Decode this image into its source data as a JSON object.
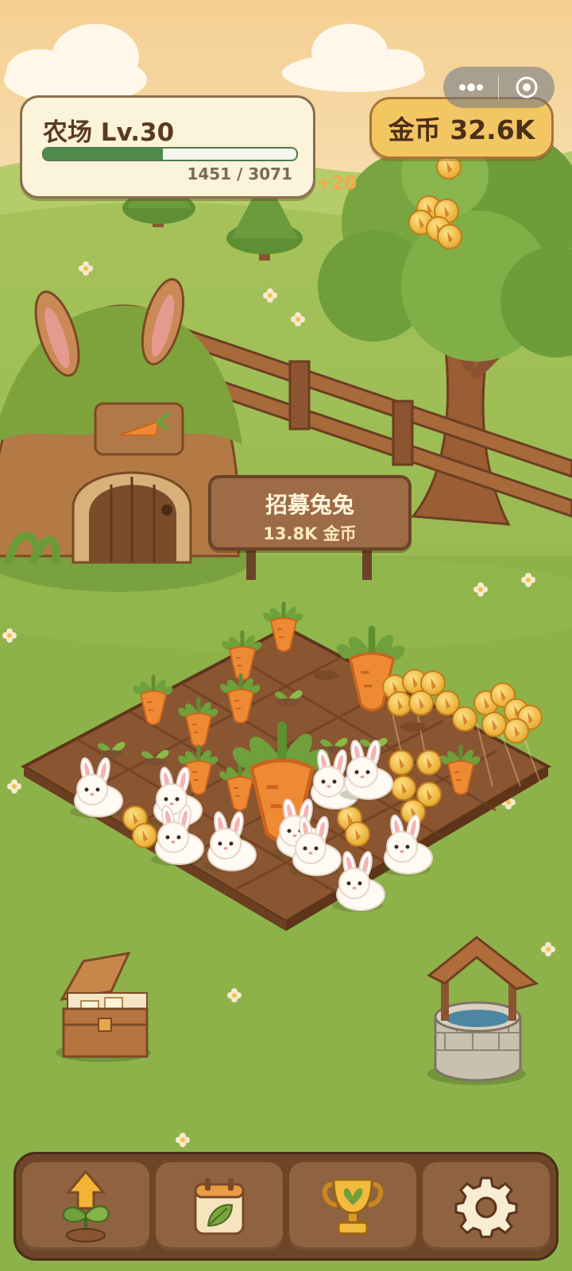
{
  "farm": {
    "level_label": "农场 Lv.30",
    "xp_current": 1451,
    "xp_max": 3071,
    "xp_text": "1451 / 3071"
  },
  "coins": {
    "label": "金币 32.6K"
  },
  "floating_gain": "+20",
  "recruit": {
    "title": "招募兔兔",
    "cost": "13.8K 金币"
  },
  "capsule": {
    "more_icon": "more-dots-icon",
    "close_icon": "target-circle-icon"
  },
  "bottom_nav": [
    {
      "name": "upgrade-sprout-button",
      "icon": "upgrade-sprout-icon"
    },
    {
      "name": "calendar-button",
      "icon": "calendar-leaf-icon"
    },
    {
      "name": "trophy-button",
      "icon": "trophy-icon"
    },
    {
      "name": "settings-button",
      "icon": "gear-icon"
    }
  ],
  "colors": {
    "grass": "#8fb54a",
    "sky": "#f6d69b",
    "coin": "#f3c664",
    "wood": "#6d4528"
  }
}
